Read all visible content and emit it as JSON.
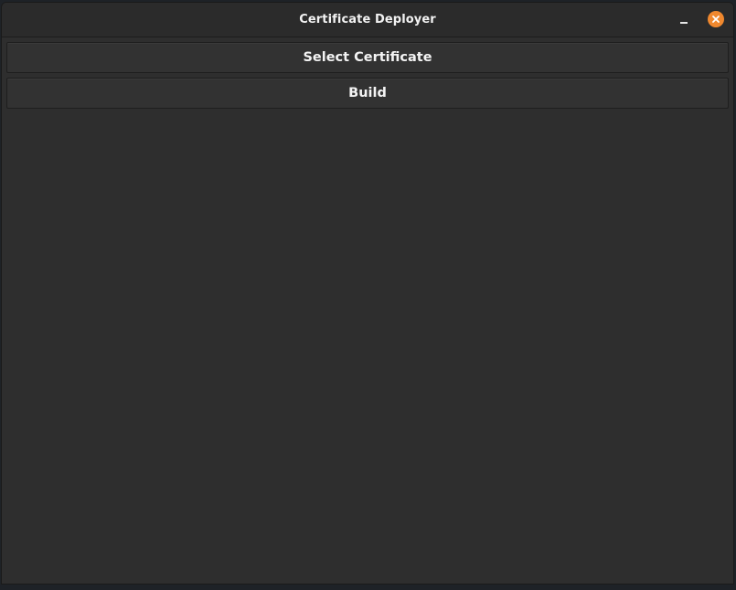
{
  "window": {
    "title": "Certificate Deployer"
  },
  "titlebar": {
    "minimize_icon": "minimize-icon",
    "close_icon": "close-icon",
    "close_color": "#f0882e"
  },
  "actions": {
    "select_certificate_label": "Select Certificate",
    "build_label": "Build"
  },
  "colors": {
    "window_bg": "#2e2e2e",
    "button_bg": "#323232",
    "text": "#f4f4f4"
  }
}
